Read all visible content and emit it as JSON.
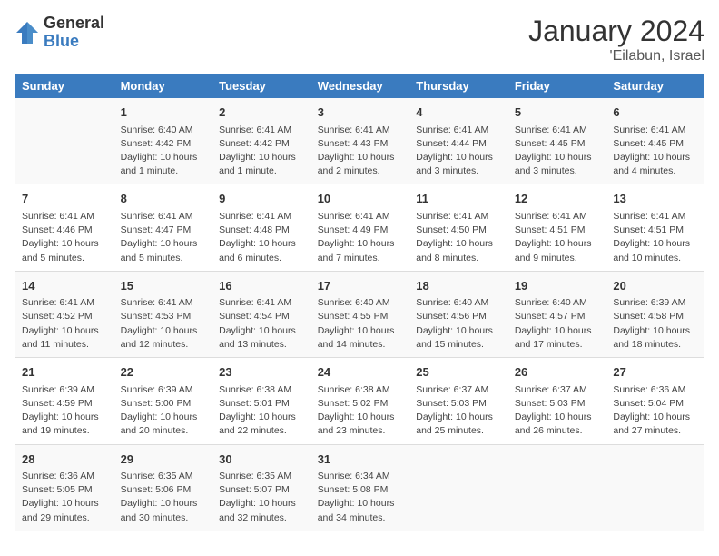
{
  "header": {
    "logo_general": "General",
    "logo_blue": "Blue",
    "title": "January 2024",
    "subtitle": "'Eilabun, Israel"
  },
  "days_of_week": [
    "Sunday",
    "Monday",
    "Tuesday",
    "Wednesday",
    "Thursday",
    "Friday",
    "Saturday"
  ],
  "weeks": [
    [
      {
        "day": "",
        "info": ""
      },
      {
        "day": "1",
        "info": "Sunrise: 6:40 AM\nSunset: 4:42 PM\nDaylight: 10 hours\nand 1 minute."
      },
      {
        "day": "2",
        "info": "Sunrise: 6:41 AM\nSunset: 4:42 PM\nDaylight: 10 hours\nand 1 minute."
      },
      {
        "day": "3",
        "info": "Sunrise: 6:41 AM\nSunset: 4:43 PM\nDaylight: 10 hours\nand 2 minutes."
      },
      {
        "day": "4",
        "info": "Sunrise: 6:41 AM\nSunset: 4:44 PM\nDaylight: 10 hours\nand 3 minutes."
      },
      {
        "day": "5",
        "info": "Sunrise: 6:41 AM\nSunset: 4:45 PM\nDaylight: 10 hours\nand 3 minutes."
      },
      {
        "day": "6",
        "info": "Sunrise: 6:41 AM\nSunset: 4:45 PM\nDaylight: 10 hours\nand 4 minutes."
      }
    ],
    [
      {
        "day": "7",
        "info": "Sunrise: 6:41 AM\nSunset: 4:46 PM\nDaylight: 10 hours\nand 5 minutes."
      },
      {
        "day": "8",
        "info": "Sunrise: 6:41 AM\nSunset: 4:47 PM\nDaylight: 10 hours\nand 5 minutes."
      },
      {
        "day": "9",
        "info": "Sunrise: 6:41 AM\nSunset: 4:48 PM\nDaylight: 10 hours\nand 6 minutes."
      },
      {
        "day": "10",
        "info": "Sunrise: 6:41 AM\nSunset: 4:49 PM\nDaylight: 10 hours\nand 7 minutes."
      },
      {
        "day": "11",
        "info": "Sunrise: 6:41 AM\nSunset: 4:50 PM\nDaylight: 10 hours\nand 8 minutes."
      },
      {
        "day": "12",
        "info": "Sunrise: 6:41 AM\nSunset: 4:51 PM\nDaylight: 10 hours\nand 9 minutes."
      },
      {
        "day": "13",
        "info": "Sunrise: 6:41 AM\nSunset: 4:51 PM\nDaylight: 10 hours\nand 10 minutes."
      }
    ],
    [
      {
        "day": "14",
        "info": "Sunrise: 6:41 AM\nSunset: 4:52 PM\nDaylight: 10 hours\nand 11 minutes."
      },
      {
        "day": "15",
        "info": "Sunrise: 6:41 AM\nSunset: 4:53 PM\nDaylight: 10 hours\nand 12 minutes."
      },
      {
        "day": "16",
        "info": "Sunrise: 6:41 AM\nSunset: 4:54 PM\nDaylight: 10 hours\nand 13 minutes."
      },
      {
        "day": "17",
        "info": "Sunrise: 6:40 AM\nSunset: 4:55 PM\nDaylight: 10 hours\nand 14 minutes."
      },
      {
        "day": "18",
        "info": "Sunrise: 6:40 AM\nSunset: 4:56 PM\nDaylight: 10 hours\nand 15 minutes."
      },
      {
        "day": "19",
        "info": "Sunrise: 6:40 AM\nSunset: 4:57 PM\nDaylight: 10 hours\nand 17 minutes."
      },
      {
        "day": "20",
        "info": "Sunrise: 6:39 AM\nSunset: 4:58 PM\nDaylight: 10 hours\nand 18 minutes."
      }
    ],
    [
      {
        "day": "21",
        "info": "Sunrise: 6:39 AM\nSunset: 4:59 PM\nDaylight: 10 hours\nand 19 minutes."
      },
      {
        "day": "22",
        "info": "Sunrise: 6:39 AM\nSunset: 5:00 PM\nDaylight: 10 hours\nand 20 minutes."
      },
      {
        "day": "23",
        "info": "Sunrise: 6:38 AM\nSunset: 5:01 PM\nDaylight: 10 hours\nand 22 minutes."
      },
      {
        "day": "24",
        "info": "Sunrise: 6:38 AM\nSunset: 5:02 PM\nDaylight: 10 hours\nand 23 minutes."
      },
      {
        "day": "25",
        "info": "Sunrise: 6:37 AM\nSunset: 5:03 PM\nDaylight: 10 hours\nand 25 minutes."
      },
      {
        "day": "26",
        "info": "Sunrise: 6:37 AM\nSunset: 5:03 PM\nDaylight: 10 hours\nand 26 minutes."
      },
      {
        "day": "27",
        "info": "Sunrise: 6:36 AM\nSunset: 5:04 PM\nDaylight: 10 hours\nand 27 minutes."
      }
    ],
    [
      {
        "day": "28",
        "info": "Sunrise: 6:36 AM\nSunset: 5:05 PM\nDaylight: 10 hours\nand 29 minutes."
      },
      {
        "day": "29",
        "info": "Sunrise: 6:35 AM\nSunset: 5:06 PM\nDaylight: 10 hours\nand 30 minutes."
      },
      {
        "day": "30",
        "info": "Sunrise: 6:35 AM\nSunset: 5:07 PM\nDaylight: 10 hours\nand 32 minutes."
      },
      {
        "day": "31",
        "info": "Sunrise: 6:34 AM\nSunset: 5:08 PM\nDaylight: 10 hours\nand 34 minutes."
      },
      {
        "day": "",
        "info": ""
      },
      {
        "day": "",
        "info": ""
      },
      {
        "day": "",
        "info": ""
      }
    ]
  ]
}
